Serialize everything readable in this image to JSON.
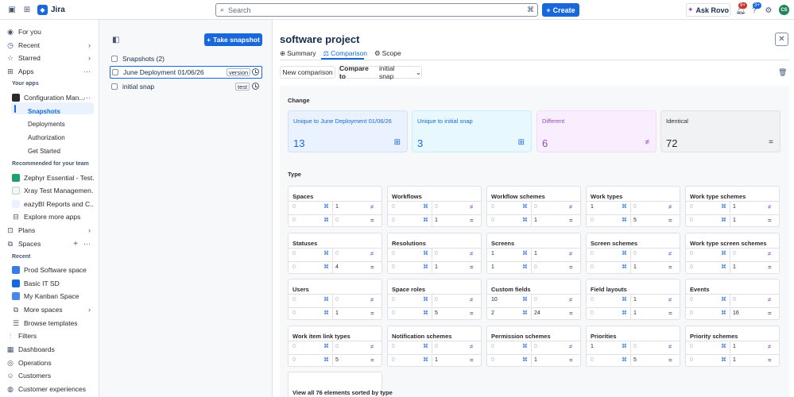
{
  "topbar": {
    "app_name": "Jira",
    "search_placeholder": "Search",
    "create_label": "Create",
    "ask_rovo_label": "Ask Rovo",
    "notifications_badge": "9+",
    "help_badge": "3+",
    "avatar_initials": "CS"
  },
  "sidebar": {
    "for_you": "For you",
    "recent": "Recent",
    "starred": "Starred",
    "apps": "Apps",
    "your_apps_heading": "Your apps",
    "config_manager": "Configuration Man...",
    "snapshots": "Snapshots",
    "deployments": "Deployments",
    "authorization": "Authorization",
    "get_started": "Get Started",
    "recommended_heading": "Recommended for your team",
    "zephyr": "Zephyr Essential - Test...",
    "xray": "Xray Test Managemen...",
    "eazybi": "eazyBI Reports and C...",
    "explore_apps": "Explore more apps",
    "plans": "Plans",
    "spaces": "Spaces",
    "recent_heading": "Recent",
    "prod_space": "Prod Software space",
    "basic_it": "Basic IT SD",
    "kanban": "My Kanban Space",
    "more_spaces": "More spaces",
    "browse_templates": "Browse templates",
    "filters": "Filters",
    "dashboards": "Dashboards",
    "operations": "Operations",
    "customers": "Customers",
    "customer_experiences": "Customer experiences"
  },
  "snapshots_panel": {
    "take_snapshot_label": "Take snapshot",
    "header_label": "Snapshots (2)",
    "items": [
      {
        "name": "June Deployment 01/06/26",
        "tag": "version"
      },
      {
        "name": "initial snap",
        "tag": "test"
      }
    ]
  },
  "main": {
    "title": "software project",
    "tabs": [
      "Summary",
      "Comparison",
      "Scope"
    ],
    "new_comparison_label": "New comparison",
    "compare_prefix": "Compare to",
    "compare_target": "initial snap",
    "change_heading": "Change",
    "type_heading": "Type",
    "summary": [
      {
        "label": "Unique to June Deployment 01/06/26",
        "value": "13",
        "bg": "#e9f2fe",
        "border": "#cfe1fd",
        "color": "#1868db"
      },
      {
        "label": "Unique to initial snap",
        "value": "3",
        "bg": "#e7f9ff",
        "border": "#c6edfb",
        "color": "#1868db"
      },
      {
        "label": "Different",
        "value": "6",
        "bg": "#f8eefe",
        "border": "#efdcfa",
        "color": "#964ac0"
      },
      {
        "label": "Identical",
        "value": "72",
        "bg": "#f1f2f4",
        "border": "#dfe1e6",
        "color": "#292a2e"
      }
    ],
    "cards": [
      {
        "title": "Spaces",
        "v": [
          "0",
          "0",
          "1",
          "0",
          "0",
          "0"
        ]
      },
      {
        "title": "Workflows",
        "v": [
          "0",
          "0",
          "0",
          "0",
          "0",
          "1"
        ]
      },
      {
        "title": "Workflow schemes",
        "v": [
          "0",
          "0",
          "0",
          "0",
          "0",
          "1"
        ]
      },
      {
        "title": "Work types",
        "v": [
          "1",
          "0",
          "0",
          "0",
          "0",
          "5"
        ]
      },
      {
        "title": "Work type schemes",
        "v": [
          "0",
          "0",
          "1",
          "0",
          "0",
          "1"
        ]
      },
      {
        "title": "Statuses",
        "v": [
          "0",
          "0",
          "0",
          "0",
          "0",
          "4"
        ]
      },
      {
        "title": "Resolutions",
        "v": [
          "0",
          "0",
          "0",
          "0",
          "0",
          "1"
        ]
      },
      {
        "title": "Screens",
        "v": [
          "1",
          "0",
          "1",
          "1",
          "0",
          "0"
        ]
      },
      {
        "title": "Screen schemes",
        "v": [
          "0",
          "0",
          "0",
          "0",
          "0",
          "1"
        ]
      },
      {
        "title": "Work type screen schemes",
        "v": [
          "0",
          "0",
          "0",
          "0",
          "0",
          "1"
        ]
      },
      {
        "title": "Users",
        "v": [
          "0",
          "0",
          "0",
          "0",
          "0",
          "1"
        ]
      },
      {
        "title": "Space roles",
        "v": [
          "0",
          "0",
          "0",
          "0",
          "0",
          "5"
        ]
      },
      {
        "title": "Custom fields",
        "v": [
          "10",
          "0",
          "0",
          "2",
          "0",
          "24"
        ]
      },
      {
        "title": "Field layouts",
        "v": [
          "0",
          "0",
          "1",
          "0",
          "0",
          "1"
        ]
      },
      {
        "title": "Events",
        "v": [
          "0",
          "0",
          "0",
          "0",
          "0",
          "16"
        ]
      },
      {
        "title": "Work item link types",
        "v": [
          "0",
          "0",
          "0",
          "0",
          "0",
          "5"
        ]
      },
      {
        "title": "Notification schemes",
        "v": [
          "0",
          "0",
          "0",
          "0",
          "0",
          "1"
        ]
      },
      {
        "title": "Permission schemes",
        "v": [
          "0",
          "0",
          "0",
          "0",
          "0",
          "1"
        ]
      },
      {
        "title": "Priorities",
        "v": [
          "1",
          "0",
          "0",
          "0",
          "0",
          "5"
        ]
      },
      {
        "title": "Priority schemes",
        "v": [
          "0",
          "0",
          "1",
          "0",
          "0",
          "1"
        ]
      }
    ],
    "view_all_label": "View all 76 elements sorted by type"
  }
}
